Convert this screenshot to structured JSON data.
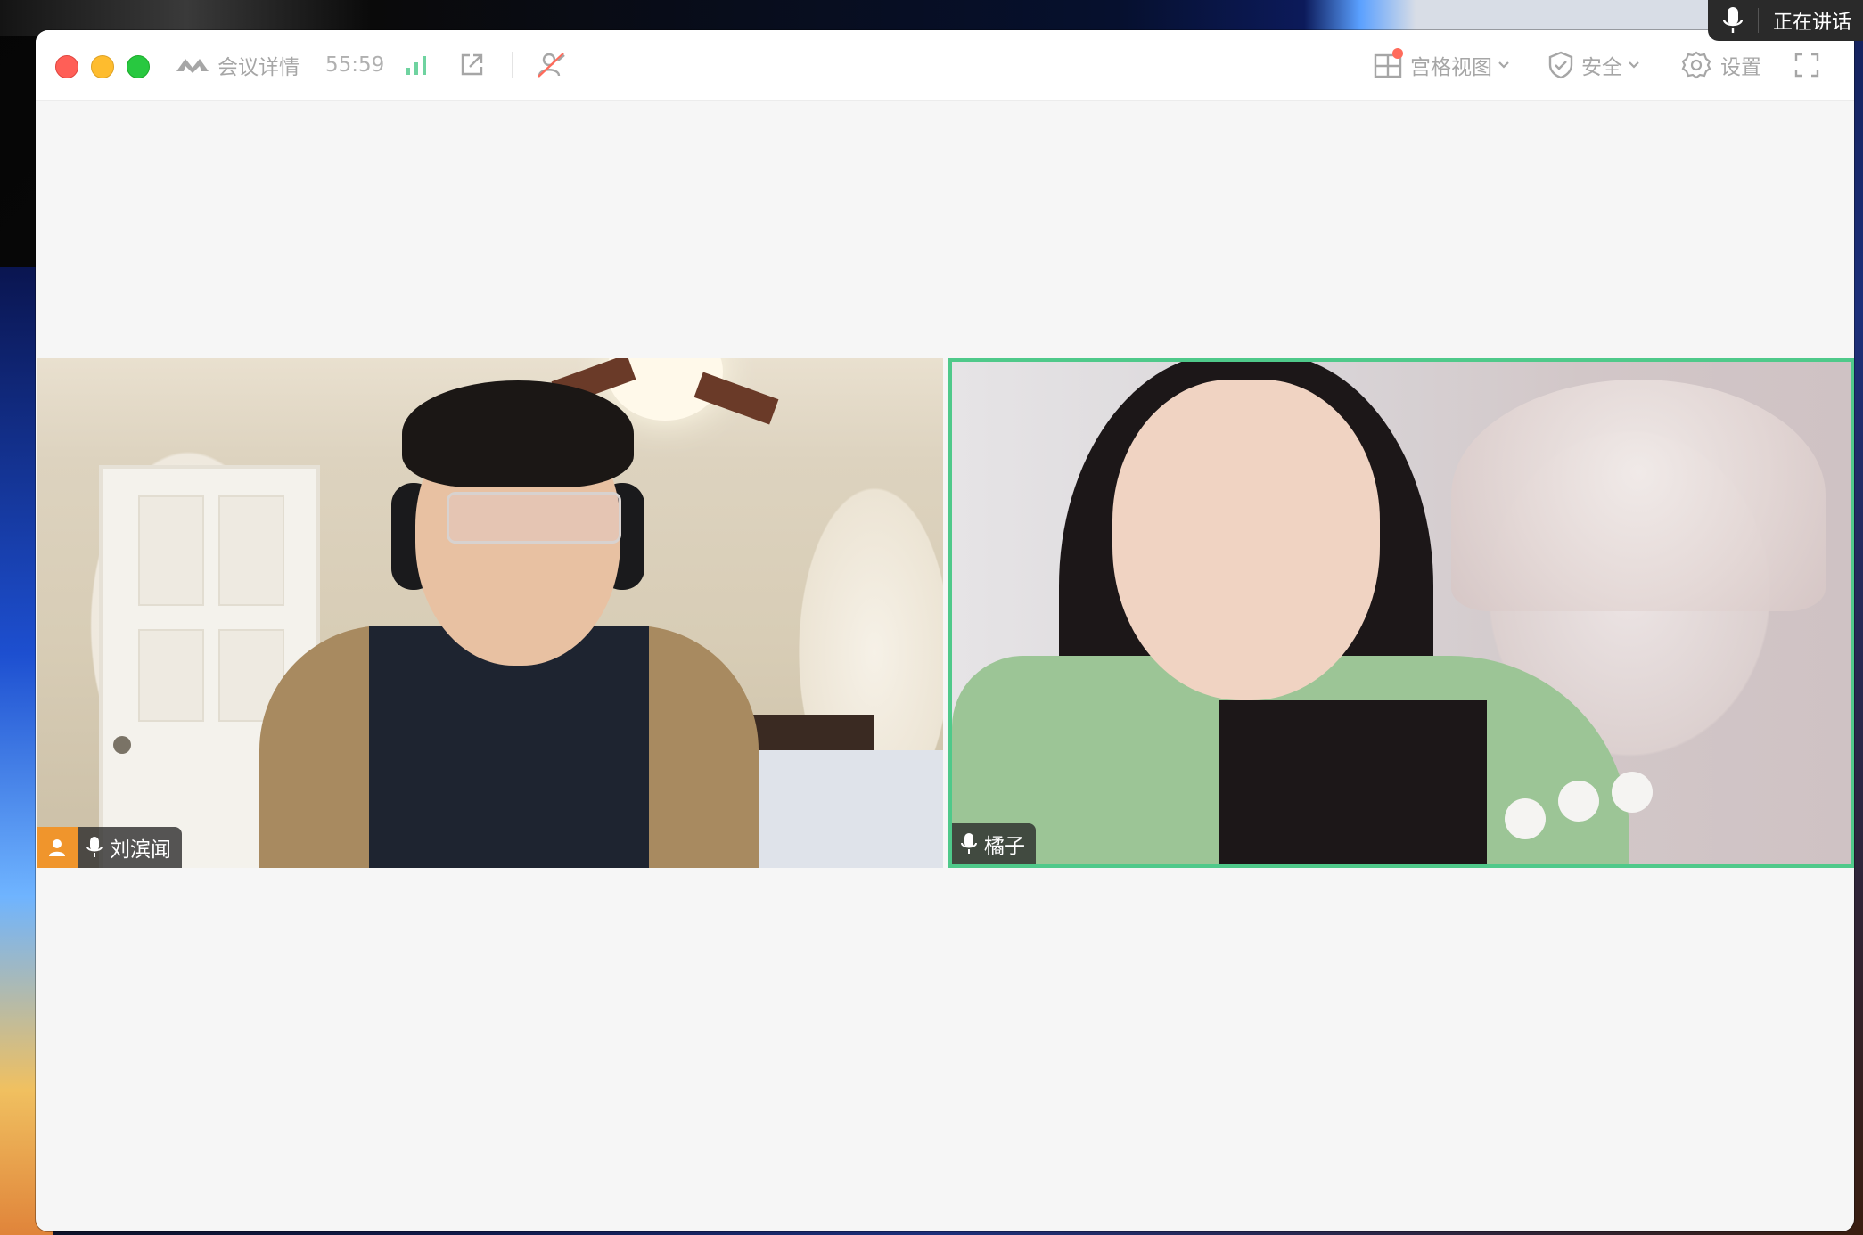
{
  "titlebar": {
    "meeting_details_label": "会议详情",
    "duration": "55:59",
    "grid_view_label": "宫格视图",
    "security_label": "安全",
    "settings_label": "设置"
  },
  "participants": [
    {
      "name": "刘滨闻",
      "is_host": true,
      "mic": "on",
      "speaking": false
    },
    {
      "name": "橘子",
      "is_host": false,
      "mic": "on",
      "speaking": true
    }
  ],
  "speaking_indicator": {
    "label": "正在讲话"
  },
  "colors": {
    "active_speaker_border": "#4fc98a",
    "host_badge": "#f0952c",
    "signal_bars": "#6fd3a0",
    "grid_view_dot": "#ff6b5b"
  },
  "icons": {
    "logo": "tencent-meeting-logo-icon",
    "signal": "signal-bars-icon",
    "share": "external-share-icon",
    "mute_presence": "hide-self-icon",
    "grid": "grid-view-icon",
    "security": "shield-icon",
    "settings": "gear-icon",
    "fullscreen": "fullscreen-icon",
    "mic": "microphone-icon",
    "host": "person-icon"
  }
}
